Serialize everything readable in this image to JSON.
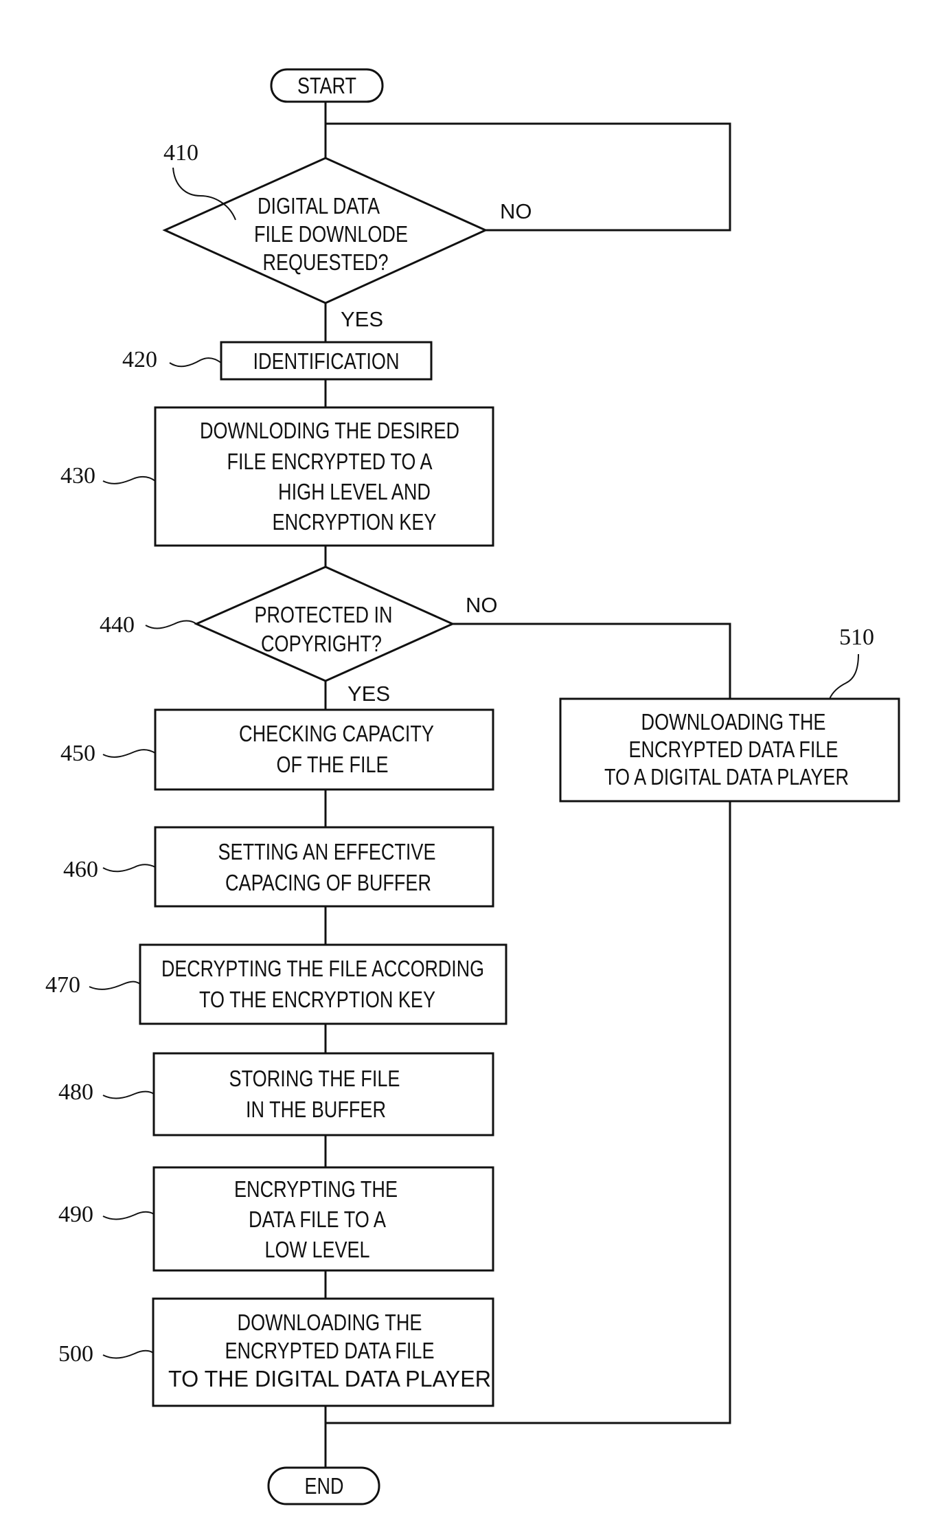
{
  "diagram": {
    "type": "flowchart",
    "start": "START",
    "end": "END",
    "steps": [
      {
        "ref": "410",
        "kind": "decision",
        "lines": [
          "DIGITAL DATA",
          "FILE DOWNLODE",
          "REQUESTED?"
        ],
        "yes": "YES",
        "no": "NO"
      },
      {
        "ref": "420",
        "kind": "process",
        "lines": [
          "IDENTIFICATION"
        ]
      },
      {
        "ref": "430",
        "kind": "process",
        "lines": [
          "DOWNLODING THE DESIRED",
          "FILE ENCRYPTED TO A",
          "HIGH LEVEL AND",
          "ENCRYPTION KEY"
        ]
      },
      {
        "ref": "440",
        "kind": "decision",
        "lines": [
          "PROTECTED IN",
          "COPYRIGHT?"
        ],
        "yes": "YES",
        "no": "NO"
      },
      {
        "ref": "450",
        "kind": "process",
        "lines": [
          "CHECKING CAPACITY",
          "OF THE FILE"
        ]
      },
      {
        "ref": "460",
        "kind": "process",
        "lines": [
          "SETTING AN EFFECTIVE",
          "CAPACING OF BUFFER"
        ]
      },
      {
        "ref": "470",
        "kind": "process",
        "lines": [
          "DECRYPTING THE FILE ACCORDING",
          "TO THE ENCRYPTION KEY"
        ]
      },
      {
        "ref": "480",
        "kind": "process",
        "lines": [
          "STORING THE FILE",
          "IN THE BUFFER"
        ]
      },
      {
        "ref": "490",
        "kind": "process",
        "lines": [
          "ENCRYPTING THE",
          "DATA FILE TO A",
          "LOW LEVEL"
        ]
      },
      {
        "ref": "500",
        "kind": "process",
        "lines": [
          "DOWNLOADING THE",
          "ENCRYPTED DATA FILE",
          "TO THE DIGITAL DATA PLAYER"
        ]
      },
      {
        "ref": "510",
        "kind": "process",
        "lines": [
          "DOWNLOADING THE",
          "ENCRYPTED DATA FILE",
          "TO A DIGITAL DATA PLAYER"
        ]
      }
    ]
  }
}
